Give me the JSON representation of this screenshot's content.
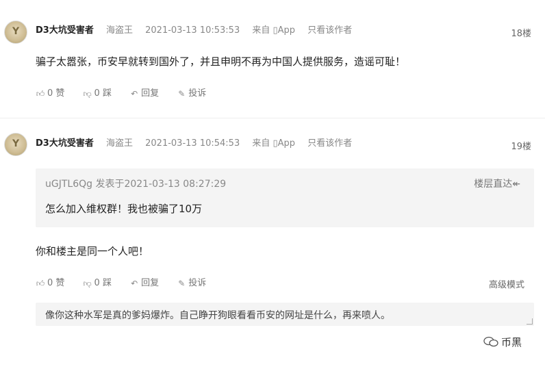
{
  "comments": [
    {
      "username": "D3大坑受害者",
      "role": "海盗王",
      "timestamp": "2021-03-13 10:53:53",
      "source": "来自 ▯App",
      "only_author": "只看该作者",
      "floor": "18楼",
      "content": "骗子太嚣张，币安早就转到国外了，并且申明不再为中国人提供服务，造谣可耻！",
      "like": "0 赞",
      "dislike": "0 踩",
      "reply": "回复",
      "report": "投诉"
    },
    {
      "username": "D3大坑受害者",
      "role": "海盗王",
      "timestamp": "2021-03-13 10:54:53",
      "source": "来自 ▯App",
      "only_author": "只看该作者",
      "floor": "19楼",
      "quote": {
        "header": "uGJTL6Qg 发表于2021-03-13 08:27:29",
        "jump": "楼层直达",
        "text": "怎么加入维权群！我也被骗了10万"
      },
      "content": "你和楼主是同一个人吧！",
      "like": "0 赞",
      "dislike": "0 踩",
      "reply": "回复",
      "report": "投诉"
    }
  ],
  "advanced_mode": "高级模式",
  "reply_input": {
    "value": "像你这种水军是真的爹妈爆炸。自己睁开狗眼看看币安的网址是什么，再来喷人。"
  },
  "watermark": "币黑"
}
